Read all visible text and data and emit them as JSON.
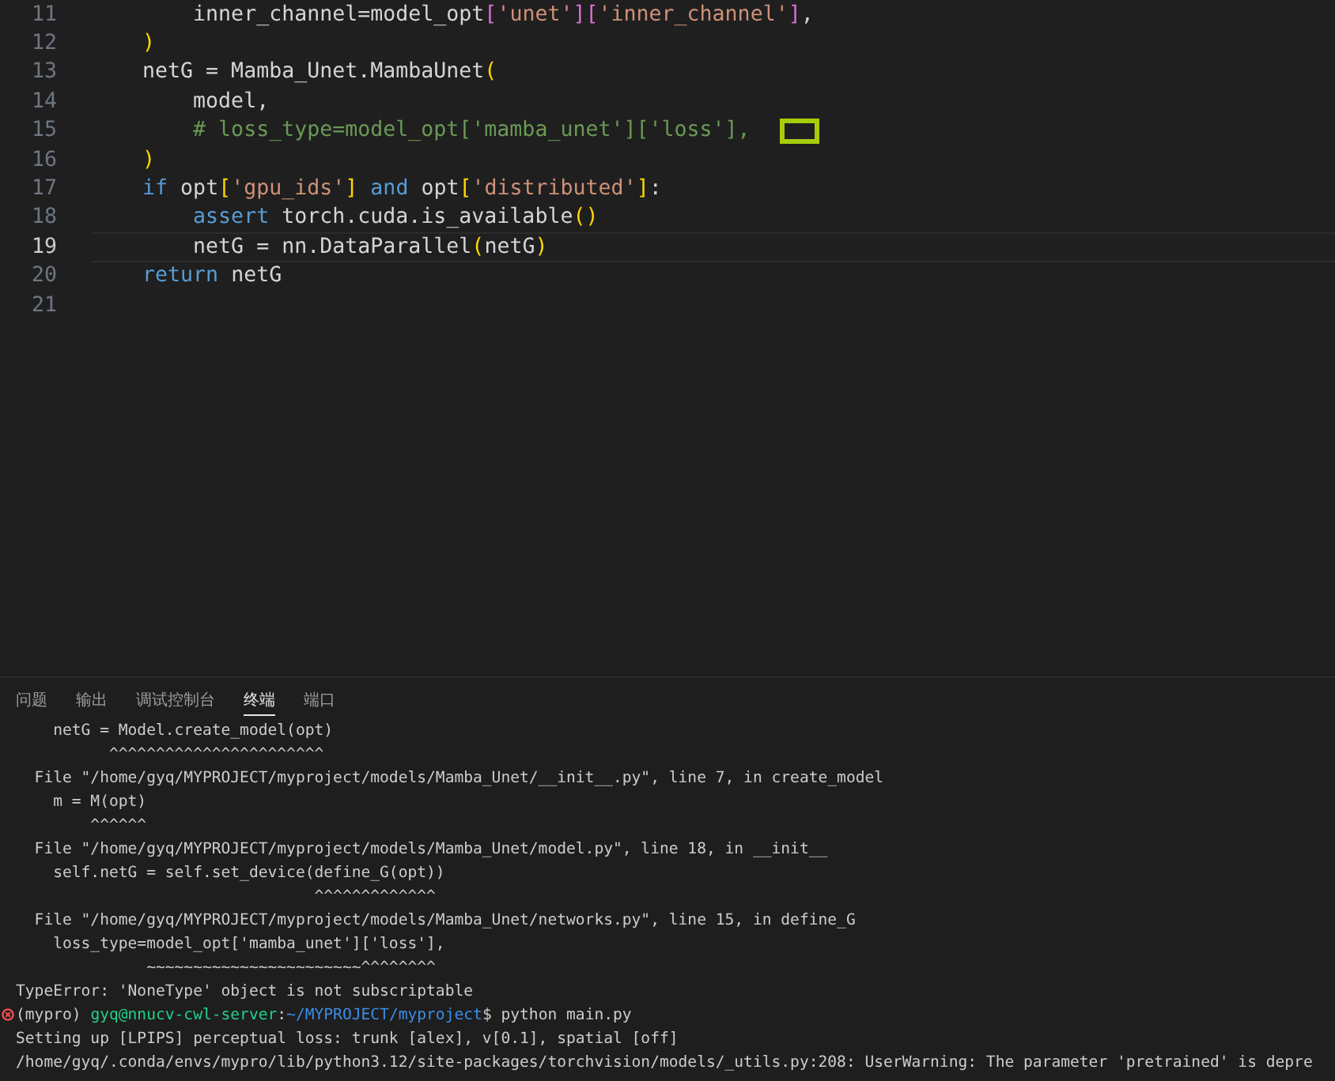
{
  "editor": {
    "lines": [
      {
        "number": "11",
        "current": false,
        "marked": false,
        "tokens": [
          {
            "kind": "plain",
            "text": "        inner_channel=model_opt"
          },
          {
            "kind": "bracket2",
            "text": "["
          },
          {
            "kind": "string",
            "text": "'unet'"
          },
          {
            "kind": "bracket2",
            "text": "]["
          },
          {
            "kind": "string",
            "text": "'inner_channel'"
          },
          {
            "kind": "bracket2",
            "text": "]"
          },
          {
            "kind": "plain",
            "text": ","
          }
        ]
      },
      {
        "number": "12",
        "current": false,
        "marked": false,
        "tokens": [
          {
            "kind": "bracket1",
            "text": "    )"
          }
        ]
      },
      {
        "number": "13",
        "current": false,
        "marked": false,
        "tokens": [
          {
            "kind": "plain",
            "text": "    netG = Mamba_Unet.MambaUnet"
          },
          {
            "kind": "bracket1",
            "text": "("
          }
        ]
      },
      {
        "number": "14",
        "current": false,
        "marked": false,
        "tokens": [
          {
            "kind": "plain",
            "text": "        model,"
          }
        ]
      },
      {
        "number": "15",
        "current": false,
        "marked": true,
        "tokens": [
          {
            "kind": "comment",
            "text": "        # loss_type=model_opt['mamba_unet']['loss'],"
          }
        ]
      },
      {
        "number": "16",
        "current": false,
        "marked": false,
        "tokens": [
          {
            "kind": "bracket1",
            "text": "    )"
          }
        ]
      },
      {
        "number": "17",
        "current": false,
        "marked": false,
        "tokens": [
          {
            "kind": "keyword",
            "text": "    if"
          },
          {
            "kind": "plain",
            "text": " opt"
          },
          {
            "kind": "bracket1",
            "text": "["
          },
          {
            "kind": "string",
            "text": "'gpu_ids'"
          },
          {
            "kind": "bracket1",
            "text": "]"
          },
          {
            "kind": "keyword",
            "text": " and"
          },
          {
            "kind": "plain",
            "text": " opt"
          },
          {
            "kind": "bracket1",
            "text": "["
          },
          {
            "kind": "string",
            "text": "'distributed'"
          },
          {
            "kind": "bracket1",
            "text": "]"
          },
          {
            "kind": "plain",
            "text": ":"
          }
        ]
      },
      {
        "number": "18",
        "current": false,
        "marked": false,
        "tokens": [
          {
            "kind": "keyword",
            "text": "        assert"
          },
          {
            "kind": "plain",
            "text": " torch.cuda.is_available"
          },
          {
            "kind": "bracket1",
            "text": "()"
          }
        ]
      },
      {
        "number": "19",
        "current": true,
        "marked": false,
        "tokens": [
          {
            "kind": "plain",
            "text": "        netG = nn.DataParallel"
          },
          {
            "kind": "bracket1",
            "text": "("
          },
          {
            "kind": "plain",
            "text": "netG"
          },
          {
            "kind": "bracket1",
            "text": ")"
          }
        ]
      },
      {
        "number": "20",
        "current": false,
        "marked": false,
        "tokens": [
          {
            "kind": "keyword",
            "text": "    return"
          },
          {
            "kind": "plain",
            "text": " netG"
          }
        ]
      },
      {
        "number": "21",
        "current": false,
        "marked": false
      }
    ]
  },
  "panel": {
    "tabs": [
      {
        "label": "问题",
        "selected": false
      },
      {
        "label": "输出",
        "selected": false
      },
      {
        "label": "调试控制台",
        "selected": false
      },
      {
        "label": "终端",
        "selected": true
      },
      {
        "label": "端口",
        "selected": false
      }
    ]
  },
  "terminal": {
    "lines": [
      {
        "kind": "output",
        "text": "    netG = Model.create_model(opt)"
      },
      {
        "kind": "output",
        "text": "          ^^^^^^^^^^^^^^^^^^^^^^^"
      },
      {
        "kind": "output",
        "text": "  File \"/home/gyq/MYPROJECT/myproject/models/Mamba_Unet/__init__.py\", line 7, in create_model"
      },
      {
        "kind": "output",
        "text": "    m = M(opt)"
      },
      {
        "kind": "output",
        "text": "        ^^^^^^"
      },
      {
        "kind": "output",
        "text": "  File \"/home/gyq/MYPROJECT/myproject/models/Mamba_Unet/model.py\", line 18, in __init__"
      },
      {
        "kind": "output",
        "text": "    self.netG = self.set_device(define_G(opt))"
      },
      {
        "kind": "output",
        "text": "                                ^^^^^^^^^^^^^"
      },
      {
        "kind": "output",
        "text": "  File \"/home/gyq/MYPROJECT/myproject/models/Mamba_Unet/networks.py\", line 15, in define_G"
      },
      {
        "kind": "output",
        "text": "    loss_type=model_opt['mamba_unet']['loss'],"
      },
      {
        "kind": "output",
        "text": "              ~~~~~~~~~~~~~~~~~~~~~~~^^^^^^^^"
      },
      {
        "kind": "output",
        "text": "TypeError: 'NoneType' object is not subscriptable"
      },
      {
        "kind": "prompt",
        "error": true,
        "env": "(mypro) ",
        "user": "gyq@nnucv-cwl-server",
        "sep": ":",
        "path": "~/MYPROJECT/myproject",
        "command": "$ python main.py"
      },
      {
        "kind": "output",
        "text": "Setting up [LPIPS] perceptual loss: trunk [alex], v[0.1], spatial [off]"
      },
      {
        "kind": "output",
        "text": "/home/gyq/.conda/envs/mypro/lib/python3.12/site-packages/torchvision/models/_utils.py:208: UserWarning: The parameter 'pretrained' is depre"
      }
    ]
  }
}
